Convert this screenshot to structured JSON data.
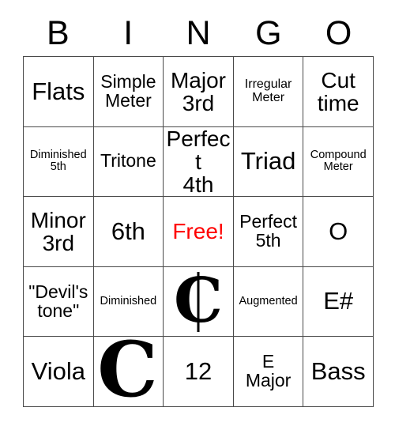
{
  "card": {
    "header_letters": [
      "B",
      "I",
      "N",
      "G",
      "O"
    ],
    "free_color": "#ff0000",
    "grid_line_color": "#4a4a4a",
    "background_color": "#ffffff",
    "text_color": "#000000"
  },
  "rows": [
    {
      "cells": [
        {
          "text": "Flats",
          "size": "xl"
        },
        {
          "text": "Simple\nMeter",
          "size": "md"
        },
        {
          "text": "Major\n3rd",
          "size": "lg"
        },
        {
          "text": "Irregular\nMeter",
          "size": "sm"
        },
        {
          "text": "Cut\ntime",
          "size": "lg"
        }
      ]
    },
    {
      "cells": [
        {
          "text": "Diminished\n5th",
          "size": "xs"
        },
        {
          "text": "Tritone",
          "size": "md"
        },
        {
          "text": "Perfect\n4th",
          "size": "lg"
        },
        {
          "text": "Triad",
          "size": "xl"
        },
        {
          "text": "Compound\nMeter",
          "size": "xs"
        }
      ]
    },
    {
      "cells": [
        {
          "text": "Minor\n3rd",
          "size": "lg"
        },
        {
          "text": "6th",
          "size": "xl"
        },
        {
          "text": "Free!",
          "size": "free"
        },
        {
          "text": "Perfect\n5th",
          "size": "md"
        },
        {
          "text": "O",
          "size": "xl"
        }
      ]
    },
    {
      "cells": [
        {
          "text": "\"Devil's\ntone\"",
          "size": "md"
        },
        {
          "text": "Diminished",
          "size": "xs"
        },
        {
          "text": "",
          "size": "symbol",
          "symbol": "cut-time",
          "symbol_glyph": "C",
          "symbol_label": "cut-time-symbol"
        },
        {
          "text": "Augmented",
          "size": "xs"
        },
        {
          "text": "E#",
          "size": "xl"
        }
      ]
    },
    {
      "cells": [
        {
          "text": "Viola",
          "size": "xl"
        },
        {
          "text": "",
          "size": "symbol",
          "symbol": "common-time",
          "symbol_glyph": "C",
          "symbol_label": "common-time-symbol"
        },
        {
          "text": "12",
          "size": "xl"
        },
        {
          "text": "E\nMajor",
          "size": "md"
        },
        {
          "text": "Bass",
          "size": "xl"
        }
      ]
    }
  ]
}
